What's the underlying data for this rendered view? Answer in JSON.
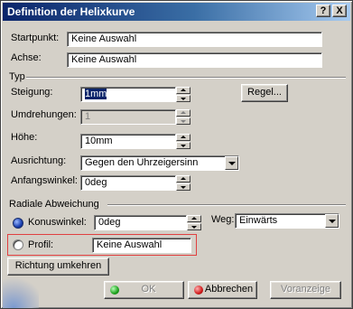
{
  "window": {
    "title": "Definition der Helixkurve",
    "help_button": "?",
    "close_button": "X"
  },
  "startpunkt": {
    "label": "Startpunkt:",
    "value": "Keine Auswahl"
  },
  "achse": {
    "label": "Achse:",
    "value": "Keine Auswahl"
  },
  "typ": {
    "group_label": "Typ",
    "steigung": {
      "label": "Steigung:",
      "value": "1mm"
    },
    "regel_button": "Regel...",
    "umdrehungen": {
      "label": "Umdrehungen:",
      "value": "1"
    },
    "hoehe": {
      "label": "Höhe:",
      "value": "10mm"
    },
    "ausrichtung": {
      "label": "Ausrichtung:",
      "value": "Gegen den Uhrzeigersinn"
    },
    "anfangswinkel": {
      "label": "Anfangswinkel:",
      "value": "0deg"
    }
  },
  "radiale_abweichung": {
    "group_label": "Radiale Abweichung",
    "konuswinkel": {
      "label": "Konuswinkel:",
      "value": "0deg",
      "selected": true
    },
    "weg": {
      "label": "Weg:",
      "value": "Einwärts"
    },
    "profil": {
      "label": "Profil:",
      "value": "Keine Auswahl",
      "selected": false
    }
  },
  "richtung_button": "Richtung umkehren",
  "footer": {
    "ok": "OK",
    "abbrechen": "Abbrechen",
    "voranzeige": "Voranzeige"
  },
  "colors": {
    "title_start": "#0a246a",
    "title_end": "#a6caf0",
    "highlight": "#e04040",
    "face": "#d4d0c8"
  }
}
